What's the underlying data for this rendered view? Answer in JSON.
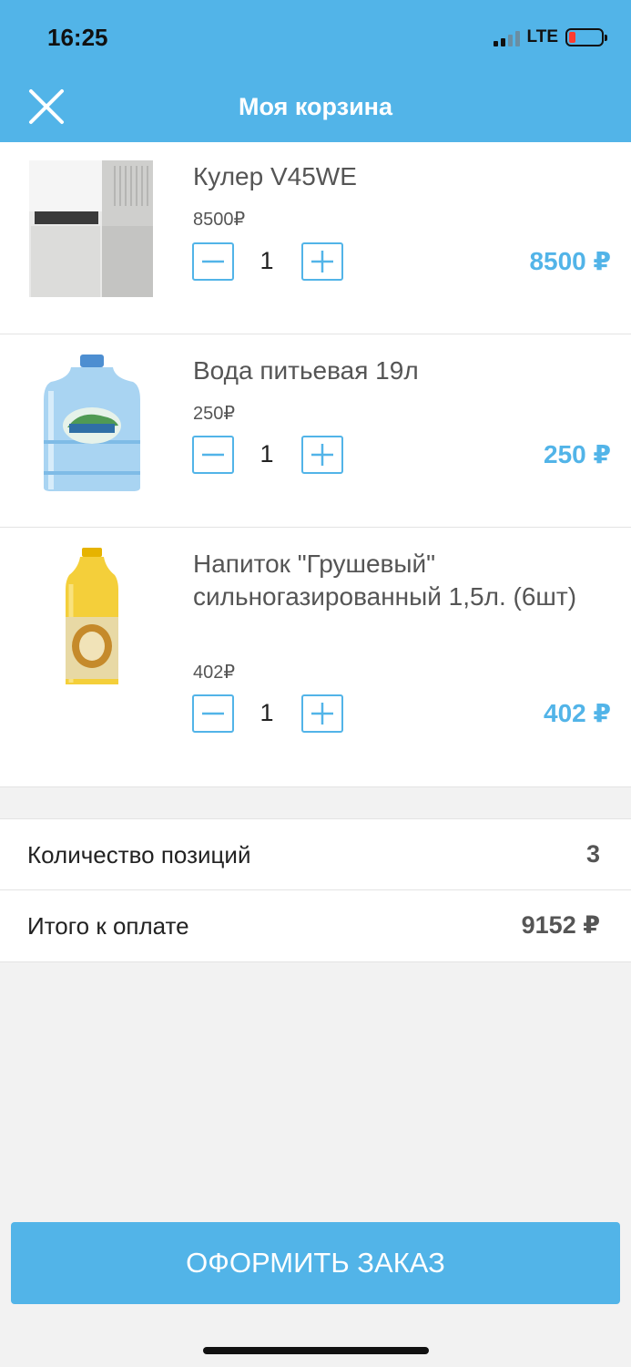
{
  "status_bar": {
    "time": "16:25",
    "network": "LTE"
  },
  "header": {
    "title": "Моя корзина"
  },
  "colors": {
    "accent": "#52b4e8",
    "battery_low": "#ff3b30"
  },
  "cart": {
    "items": [
      {
        "name": "Кулер V45WE",
        "unit_price": "8500₽",
        "quantity": "1",
        "total": "8500 ₽"
      },
      {
        "name": "Вода питьевая 19л",
        "unit_price": "250₽",
        "quantity": "1",
        "total": "250 ₽"
      },
      {
        "name": "Напиток \"Грушевый\" сильногазированный 1,5л. (6шт)",
        "unit_price": "402₽",
        "quantity": "1",
        "total": "402 ₽"
      }
    ]
  },
  "summary": {
    "positions_label": "Количество позиций",
    "positions_value": "3",
    "total_label": "Итого к оплате",
    "total_value": "9152 ₽"
  },
  "checkout": {
    "label": "ОФОРМИТЬ ЗАКАЗ"
  }
}
